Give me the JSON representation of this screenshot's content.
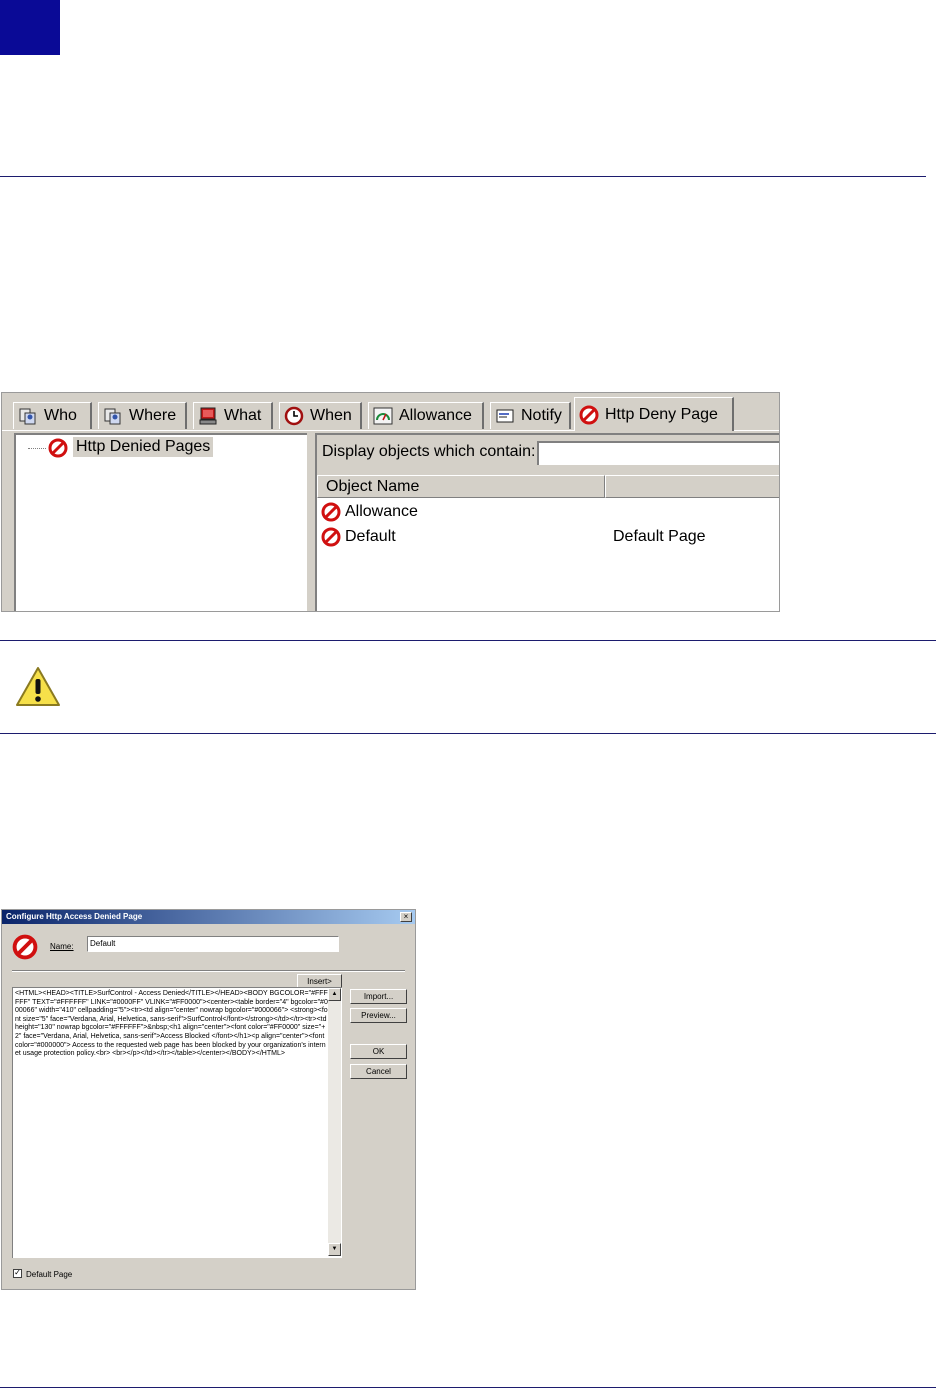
{
  "screenshot1": {
    "tabs": [
      {
        "label": "Who",
        "icon": "group-computer-icon"
      },
      {
        "label": "Where",
        "icon": "group-computer-icon"
      },
      {
        "label": "What",
        "icon": "computer-monitor-icon"
      },
      {
        "label": "When",
        "icon": "clock-icon"
      },
      {
        "label": "Allowance",
        "icon": "gauge-icon"
      },
      {
        "label": "Notify",
        "icon": "message-icon"
      },
      {
        "label": "Http Deny Page",
        "icon": "no-entry-icon"
      }
    ],
    "tree_item": "Http Denied Pages",
    "filter_label": "Display objects which contain:",
    "filter_value": "",
    "column_object_name": "Object Name",
    "rows": [
      {
        "name": "Allowance",
        "detail": ""
      },
      {
        "name": "Default",
        "detail": "Default Page"
      }
    ]
  },
  "dialog": {
    "title": "Configure Http Access Denied Page",
    "close": "×",
    "name_label": "Name:",
    "name_value": "Default",
    "insert_button": "Insert>",
    "import_button": "Import...",
    "preview_button": "Preview...",
    "ok_button": "OK",
    "cancel_button": "Cancel",
    "html_text": "<HTML><HEAD><TITLE>SurfControl - Access Denied</TITLE></HEAD><BODY BGCOLOR=\"#FFFFFF\" TEXT=\"#FFFFFF\" LINK=\"#0000FF\" VLINK=\"#FF0000\"><center><table border=\"4\" bgcolor=\"#000066\" width=\"410\" cellpadding=\"5\"><tr><td align=\"center\" nowrap bgcolor=\"#000066\"> <strong><font size=\"5\" face=\"Verdana, Arial, Helvetica, sans-serif\">SurfControl</font></strong></td></tr><tr><td height=\"130\" nowrap bgcolor=\"#FFFFFF\">&nbsp;<h1 align=\"center\"><font color=\"#FF0000\" size=\"+2\" face=\"Verdana, Arial, Helvetica, sans-serif\">Access Blocked </font></h1><p align=\"center\"><font color=\"#000000\"> Access to the requested web page has been blocked by your organization's internet usage protection policy.<br> <br></p></td></tr></table></center></BODY></HTML>",
    "default_checkbox_label": "Default Page",
    "default_checked": "✓"
  }
}
